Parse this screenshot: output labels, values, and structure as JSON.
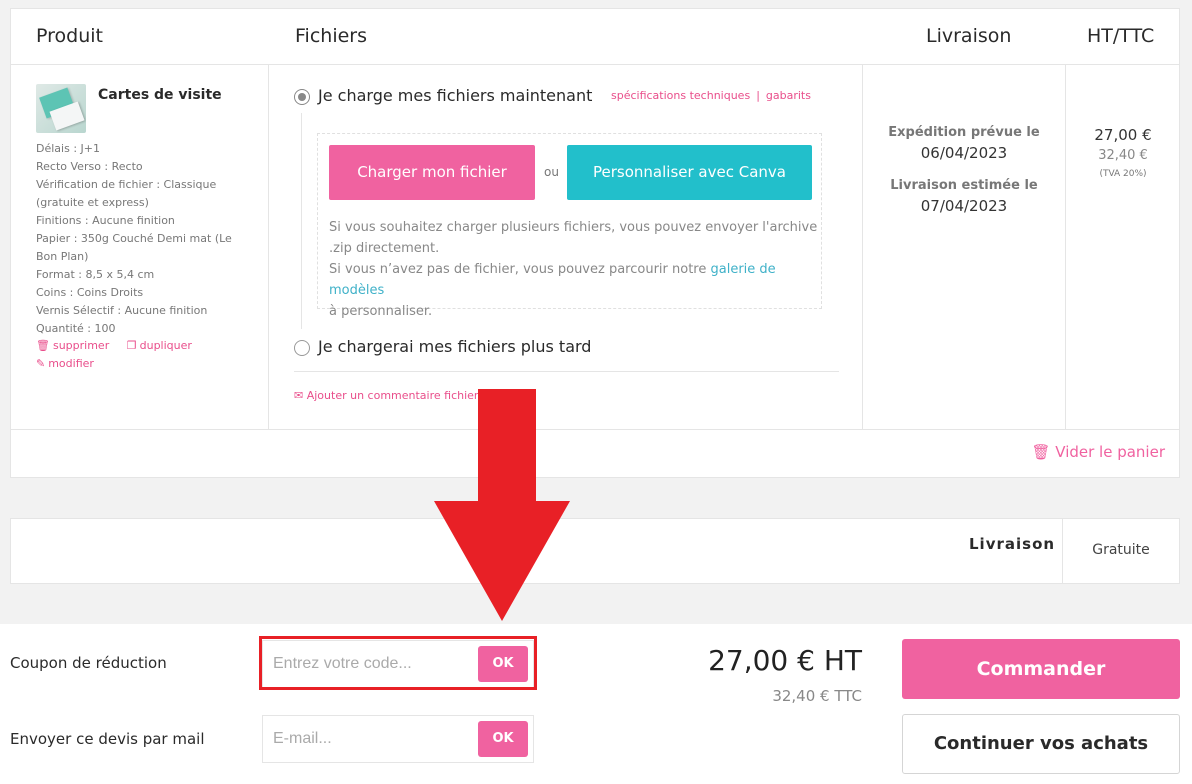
{
  "cart": {
    "headers": {
      "product": "Produit",
      "files": "Fichiers",
      "delivery": "Livraison",
      "price": "HT/TTC"
    },
    "product": {
      "name": "Cartes de visite",
      "thumbnail_icon": "business-card-thumbnail",
      "specs": [
        "Délais : J+1",
        "Recto Verso : Recto",
        "Vérification de fichier : Classique (gratuite et express)",
        "Finitions : Aucune finition",
        "Papier : 350g Couché Demi mat (Le Bon Plan)",
        "Format : 8,5 x 5,4 cm",
        "Coins : Coins Droits",
        "Vernis Sélectif : Aucune finition",
        "Quantité : 100"
      ],
      "actions": {
        "delete": "supprimer",
        "duplicate": "dupliquer",
        "edit": "modifier"
      }
    },
    "files": {
      "option_now": "Je charge mes fichiers maintenant",
      "option_now_selected": true,
      "spec_link": "spécifications techniques",
      "separator": "|",
      "templates_link": "gabarits",
      "upload_button": "Charger mon fichier",
      "or": "ou",
      "canva_button": "Personnaliser avec Canva",
      "info_line1": "Si vous souhaitez charger plusieurs fichiers, vous pouvez envoyer l'archive .zip directement.",
      "info_line2_before": "Si vous n’avez pas de fichier, vous pouvez parcourir notre",
      "info_line2_link": "galerie de modèles",
      "info_line2_after": "à personnaliser.",
      "option_later": "Je chargerai mes fichiers plus tard",
      "comment_link": "Ajouter un commentaire fichier"
    },
    "delivery": {
      "shipping_label": "Expédition prévue le",
      "shipping_date": "06/04/2023",
      "estimated_label": "Livraison estimée le",
      "estimated_date": "07/04/2023"
    },
    "price": {
      "ht": "27,00 €",
      "ttc": "32,40 €",
      "tva": "(TVA 20%)"
    },
    "empty_cart": "Vider le panier"
  },
  "shipping_row": {
    "label": "Livraison",
    "value": "Gratuite"
  },
  "checkout": {
    "coupon_label": "Coupon de réduction",
    "coupon_placeholder": "Entrez votre code...",
    "coupon_ok": "OK",
    "mail_label": "Envoyer ce devis par mail",
    "mail_placeholder": "E-mail...",
    "mail_ok": "OK",
    "total_ht": "27,00 € HT",
    "total_ttc": "32,40 € TTC",
    "order_button": "Commander",
    "continue_button": "Continuer vos achats"
  },
  "colors": {
    "accent_pink": "#f062a0",
    "canva_teal": "#22bfcb",
    "annotation_red": "#e82026"
  }
}
